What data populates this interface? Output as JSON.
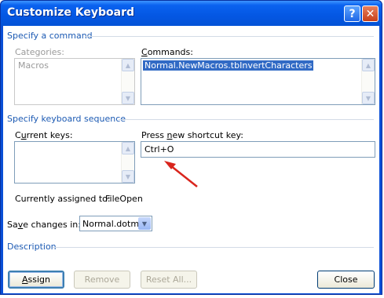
{
  "window": {
    "title": "Customize Keyboard"
  },
  "titlebar": {
    "help_glyph": "?",
    "close_glyph": "✕"
  },
  "sections": {
    "specify_command": "Specify a command",
    "keyboard_sequence": "Specify keyboard sequence",
    "description": "Description"
  },
  "categories": {
    "label": "Categories:",
    "items": [
      "Macros"
    ]
  },
  "commands": {
    "label_prefix": "C",
    "label_rest": "ommands:",
    "items": [
      "Normal.NewMacros.tbInvertCharacters"
    ]
  },
  "current_keys": {
    "label_prefix": "C",
    "label_underlined": "u",
    "label_rest": "rrent keys:"
  },
  "shortcut": {
    "label_prefix": "Press ",
    "label_underlined": "n",
    "label_rest": "ew shortcut key:",
    "value": "Ctrl+O"
  },
  "assigned": {
    "label": "Currently assigned to:",
    "value": "FileOpen"
  },
  "save_changes": {
    "label_prefix": "Sa",
    "label_underlined": "v",
    "label_rest": "e changes in:",
    "value": "Normal.dotm"
  },
  "buttons": {
    "assign_underlined": "A",
    "assign_rest": "ssign",
    "remove": "Remove",
    "reset_all": "Reset All...",
    "close": "Close"
  },
  "colors": {
    "annotation_arrow": "#d9251d",
    "section_heading": "#1c5ab3",
    "selection": "#316ac5"
  }
}
